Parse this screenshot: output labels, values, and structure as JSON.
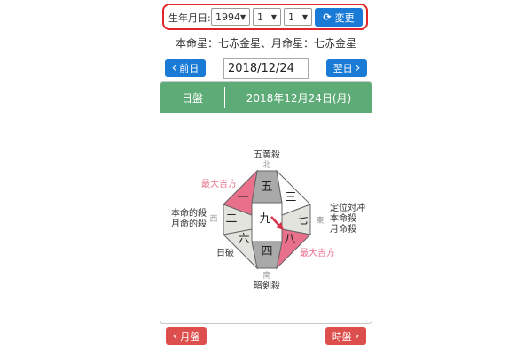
{
  "birth": {
    "label": "生年月日:",
    "year": "1994",
    "month": "1",
    "day": "1",
    "change_label": "変更",
    "arrow": "▼",
    "refresh_glyph": "⟳"
  },
  "star_info": "本命星：七赤金星、月命星：七赤金星",
  "nav": {
    "prev_label": "前日",
    "next_label": "翌日",
    "date_value": "2018/12/24",
    "prev_glyph": "‹",
    "next_glyph": "›"
  },
  "panel": {
    "title_left": "日盤",
    "title_right": "2018年12月24日(月)"
  },
  "board": {
    "center": "九",
    "cells": [
      "五",
      "三",
      "七",
      "八",
      "四",
      "六",
      "二",
      "一"
    ],
    "highlight_color": "#e8708b",
    "gray_color": "#a9a9a9",
    "light_color": "#e4e4df",
    "directions": {
      "north": "北",
      "south": "南",
      "east": "東",
      "west": "西"
    },
    "annotations": {
      "top": "五黄殺",
      "bottom": "暗剣殺",
      "upper_left": "最大吉方",
      "lower_right": "最大吉方",
      "left_1": "本命的殺",
      "left_2": "月命的殺",
      "right_1": "定位対冲",
      "right_2": "本命殺",
      "right_3": "月命殺",
      "lower_left": "日破"
    },
    "accent_color": "#d9304a"
  },
  "footer": {
    "prev_month_label": "月盤",
    "next_hour_label": "時盤"
  }
}
